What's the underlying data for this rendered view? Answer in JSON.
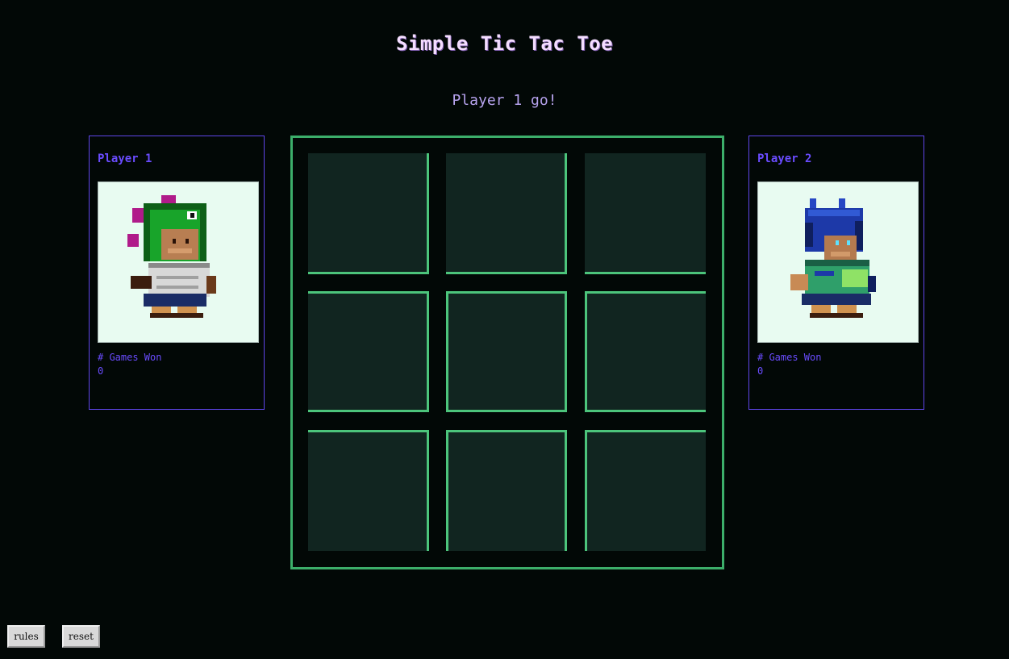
{
  "title": "Simple Tic Tac Toe",
  "status": "Player 1 go!",
  "players": [
    {
      "name": "Player 1",
      "wins_label": "# Games Won",
      "wins": "0",
      "avatar": "green-dino-hood-character-icon"
    },
    {
      "name": "Player 2",
      "wins_label": "# Games Won",
      "wins": "0",
      "avatar": "blue-hooded-character-icon"
    }
  ],
  "board": {
    "cells": [
      "",
      "",
      "",
      "",
      "",
      "",
      "",
      "",
      ""
    ]
  },
  "buttons": {
    "rules": "rules",
    "reset": "reset"
  },
  "colors": {
    "background": "#020806",
    "board_border": "#3cae6a",
    "cell_fill": "#112520",
    "player_text": "#6a4cff",
    "title": "#f4ddff"
  }
}
